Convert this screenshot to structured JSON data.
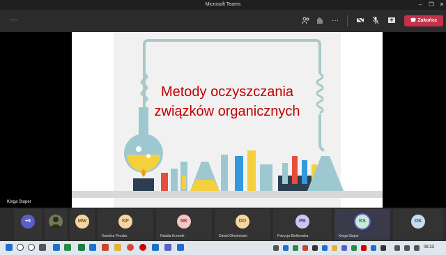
{
  "window": {
    "title": "Microsoft Teams"
  },
  "toolbar": {
    "timer": "--:--",
    "leave_label": "Zakończ"
  },
  "slide": {
    "title_line1": "Metody oczyszczania",
    "title_line2": "związków organicznych"
  },
  "presenter": {
    "name": "Kinga Stuper"
  },
  "participants": [
    {
      "initials": "+6",
      "name": "",
      "color": "#5b5fc7",
      "text": "#ffffff"
    },
    {
      "initials": "",
      "name": "",
      "color": "#6b7b5a",
      "text": "#ffffff"
    },
    {
      "initials": "MW",
      "name": "",
      "color": "#f5d5a0",
      "text": "#7a5a20"
    },
    {
      "initials": "KP",
      "name": "Karolina Peczka",
      "color": "#f5d5a0",
      "text": "#7a5a20"
    },
    {
      "initials": "NK",
      "name": "Natalia Krzewik",
      "color": "#f5c6c6",
      "text": "#8a3030"
    },
    {
      "initials": "DO",
      "name": "Dawid Okoniewski",
      "color": "#f5d5a0",
      "text": "#7a5a20"
    },
    {
      "initials": "PB",
      "name": "Patrycja Bielkowska",
      "color": "#c8c8f0",
      "text": "#3a3a8a"
    },
    {
      "initials": "KS",
      "name": "Kinga Stuper",
      "color": "#c8ead8",
      "text": "#2a6a4a"
    },
    {
      "initials": "OK",
      "name": "",
      "color": "#c8dcf0",
      "text": "#2a4a7a"
    }
  ],
  "taskbar": {
    "time": "08:23"
  },
  "colors": {
    "accent": "#5b5fc7",
    "leave": "#c4314b",
    "title_red": "#c00000"
  }
}
